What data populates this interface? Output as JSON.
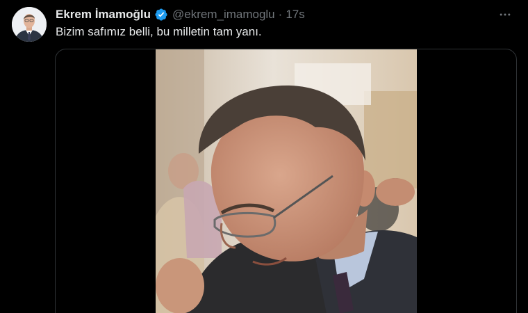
{
  "tweet": {
    "author": {
      "display_name": "Ekrem İmamoğlu",
      "handle": "@ekrem_imamoglu",
      "verified": true,
      "avatar_icon": "profile-photo"
    },
    "separator": "·",
    "timestamp": "17s",
    "text": "Bizim safımız belli, bu milletin tam yanı.",
    "more_icon": "more-horizontal-icon",
    "media": {
      "type": "video"
    }
  },
  "colors": {
    "background": "#000000",
    "text_primary": "#e7e9ea",
    "text_secondary": "#71767b",
    "verified_blue": "#1d9bf0",
    "border": "#2f3336"
  }
}
